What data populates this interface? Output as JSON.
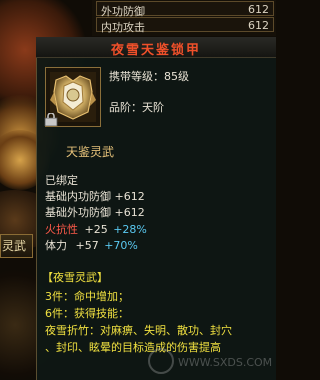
{
  "top_stats": [
    {
      "label": "外功防御",
      "value": "612"
    },
    {
      "label": "内功攻击",
      "value": "612"
    }
  ],
  "left_tab": {
    "label": "灵武"
  },
  "tooltip": {
    "title": "夜雪天鉴锁甲",
    "level": "携带等级：85级",
    "quality": "品阶：天阶",
    "item_subtitle": "天鉴灵武",
    "bound": "已绑定",
    "base_stats": [
      "基础内功防御 +612",
      "基础外功防御 +612"
    ],
    "fire_res": {
      "label": "火抗性",
      "base": "+25",
      "bonus": "+28%"
    },
    "stamina": {
      "label": "体力",
      "base": "+57",
      "bonus": "+70%"
    },
    "set_name": "【夜雪灵武】",
    "set_bonus_3": "3件：命中增加；",
    "set_bonus_6": "6件：获得技能：",
    "skill_line1": "夜雪折竹：对麻痹、失明、散功、封穴",
    "skill_line2": "、封印、眩晕的目标造成的伤害提高"
  },
  "colors": {
    "title": "#f0502a",
    "gold": "#e6c27a",
    "cyan": "#5ac8f0",
    "yellow": "#f0e040",
    "red_stat": "#ff5a4a"
  },
  "icons": [
    "armor-item-icon",
    "lock-icon"
  ],
  "watermark": "WWW.SXDS.COM"
}
